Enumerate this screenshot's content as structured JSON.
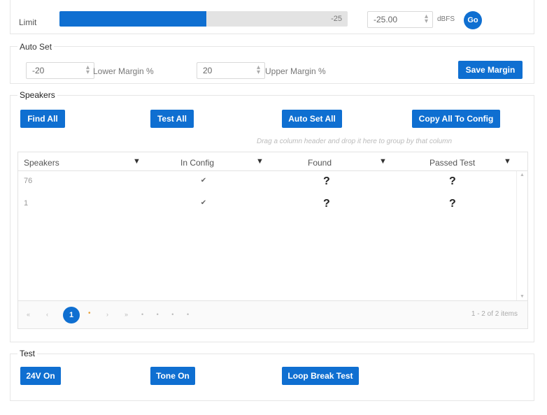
{
  "limit": {
    "label": "Limit",
    "bar_value": "-25",
    "bar_fill_fraction": 0.51,
    "input_value": "-25.00",
    "unit": "dBFS",
    "go_label": "Go"
  },
  "auto_set": {
    "legend": "Auto Set",
    "lower_value": "-20",
    "lower_label": "Lower Margin %",
    "upper_value": "20",
    "upper_label": "Upper Margin %",
    "save_label": "Save Margin"
  },
  "speakers": {
    "legend": "Speakers",
    "find_all": "Find All",
    "test_all": "Test All",
    "auto_set_all": "Auto Set All",
    "copy_all": "Copy All To Config",
    "drag_hint": "Drag a column header and drop it here to group by that column",
    "columns": [
      "Speakers",
      "In Config",
      "Found",
      "Passed Test"
    ],
    "rows": [
      {
        "speaker": "76",
        "in_config": "✔",
        "found": "?",
        "passed": "?"
      },
      {
        "speaker": "1",
        "in_config": "✔",
        "found": "?",
        "passed": "?"
      }
    ],
    "pager": {
      "first": "«",
      "prev": "‹",
      "current": "1",
      "next": "›",
      "last": "»",
      "info": "1 - 2 of 2 items"
    }
  },
  "test": {
    "legend": "Test",
    "on24v": "24V On",
    "tone_on": "Tone On",
    "loop_break": "Loop Break Test"
  },
  "colors": {
    "accent": "#0f6fd1",
    "bar_track": "#e3e3e3"
  },
  "icons": [
    "filter-icon",
    "spinner-arrows-icon",
    "checkbox-icon",
    "question-icon"
  ]
}
